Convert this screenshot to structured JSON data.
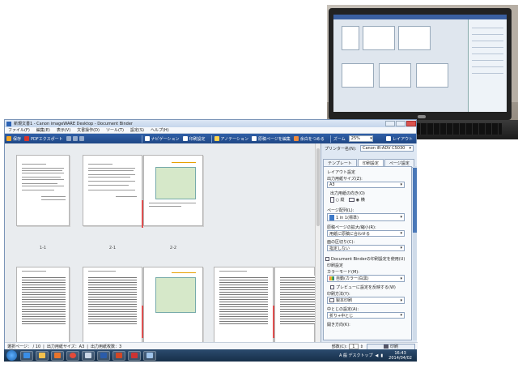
{
  "window": {
    "title": "新規文書1 - Canon imageWARE Desktop - Document Binder"
  },
  "menu": [
    "ファイル(F)",
    "編集(E)",
    "表示(V)",
    "文書操作(D)",
    "ツール(T)",
    "設定(S)",
    "ヘルプ(H)"
  ],
  "toolbar": {
    "save": "保存",
    "pdf_export": "PDFエクスポート",
    "navigation": "ナビゲーション",
    "print_settings": "印刷設定",
    "annotation": "アノテーション",
    "edit_original": "原稿ページを編集",
    "blank_fill": "余白をつめる",
    "zoom_label": "ズーム",
    "zoom_value": "25%",
    "layout": "レイアウト"
  },
  "pages": {
    "label_1": "1-1",
    "label_2a": "2-1",
    "label_2b": "2-2"
  },
  "panel": {
    "printer_label": "プリンター名(N):",
    "printer_value": "Canon iR-ADV C5030",
    "tabs": [
      "テンプレート",
      "印刷設定",
      "ページ設定"
    ],
    "layout_heading": "レイアウト設定",
    "output_size_label": "出力用紙サイズ(Z):",
    "output_size_value": "A3",
    "orientation_label": "出力用紙の向き(O)",
    "orientation_portrait": "縦",
    "orientation_landscape": "横",
    "page_layout_label": "ページ配列(L):",
    "page_layout_value": "1 in 1(標準)",
    "scale_label": "原稿ページの拡大/縮小(R):",
    "scale_value": "用紙に原稿に合わせる",
    "separator_label": "面の区切り(C):",
    "separator_value": "指定しない",
    "binder_settings": "Document Binderの印刷設定を使用(U)",
    "print_heading": "印刷設定",
    "color_mode_label": "カラーモード(M):",
    "color_mode_value": "自動(カラー/白黒)",
    "preview_reflect": "プレビューに設定を反映する(W)",
    "print_method_label": "印刷方法(Y):",
    "print_method_value": "製本印刷",
    "binding_label": "中とじの設定(A):",
    "binding_value": "折り+中とじ",
    "opening_label": "開き方向(K):"
  },
  "status": {
    "selected_page": "選択ページ： / 10",
    "output_size": "出力用紙サイズ：A3",
    "output_count": "出力用紙枚数：3",
    "copies_label": "部数(C):",
    "copies_value": "1",
    "print_button": "印刷"
  },
  "taskbar": {
    "tray_text": "A 般 デスクトップ",
    "time": "16:43",
    "date": "2014/04/02"
  },
  "colors": {
    "toolbar": "#2f5fa7",
    "panel": "#dfe8f3",
    "taskbar": "#1f3a5a"
  }
}
